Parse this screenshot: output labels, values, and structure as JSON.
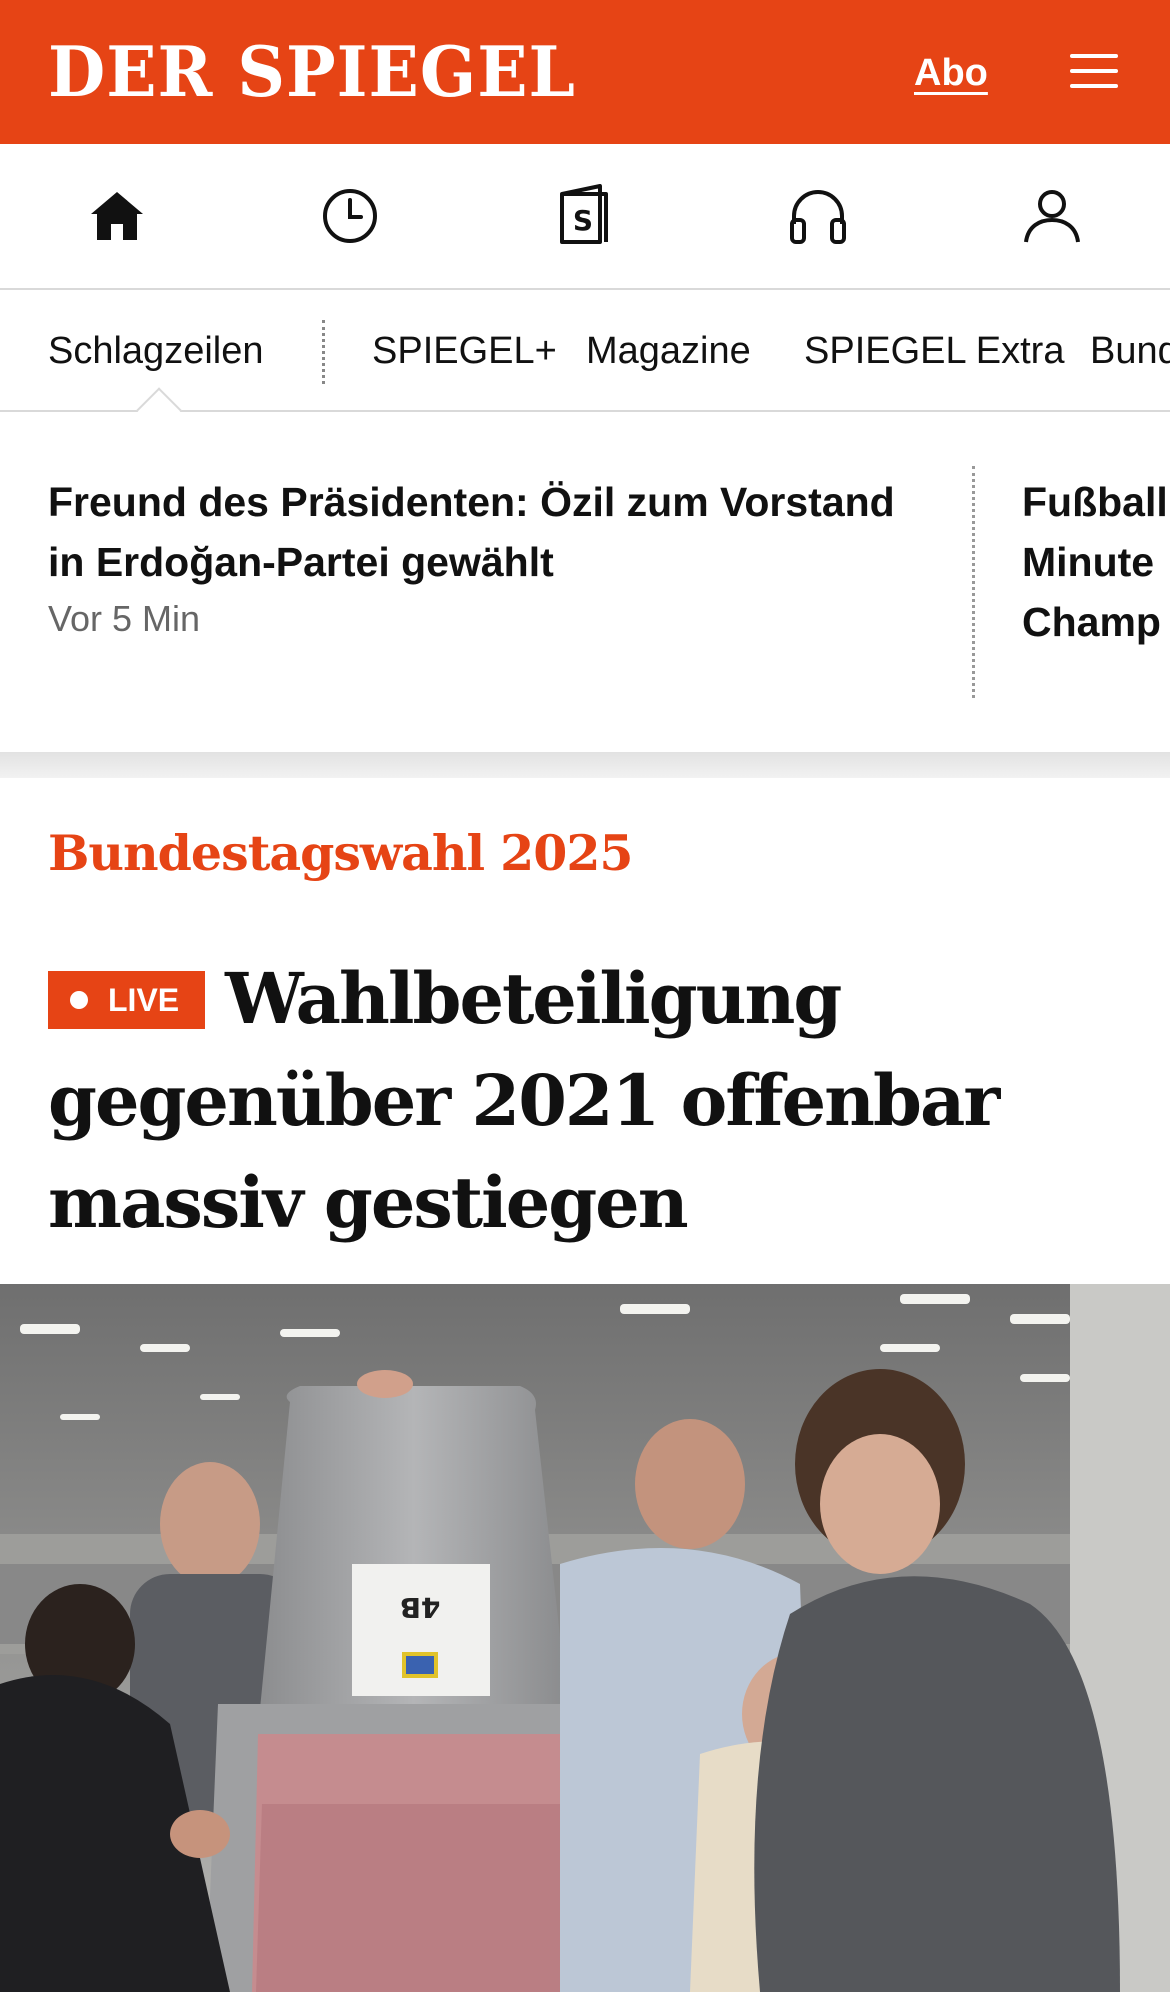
{
  "header": {
    "logo": "DER SPIEGEL",
    "abo_label": "Abo",
    "brand_color": "#e64415"
  },
  "icon_nav": [
    {
      "icon": "home-icon"
    },
    {
      "icon": "clock-icon"
    },
    {
      "icon": "spiegel-plus-icon"
    },
    {
      "icon": "headphones-icon"
    },
    {
      "icon": "user-icon"
    }
  ],
  "section_nav": {
    "items": [
      "Schlagzeilen",
      "SPIEGEL+",
      "Magazine",
      "SPIEGEL Extra",
      "Bundestagswahl"
    ]
  },
  "teasers": [
    {
      "title": "Freund des Präsidenten: Özil zum Vorstand in Erdoğan-Partei gewählt",
      "time": "Vor 5 Min"
    },
    {
      "title_lines": [
        "Fußball",
        "Minute",
        "Champ"
      ]
    }
  ],
  "article": {
    "kicker": "Bundestagswahl 2025",
    "badge": "LIVE",
    "headline": "Wahlbeteiligung gegenüber 2021 offenbar massiv gestiegen",
    "ballot_label": "4B"
  }
}
